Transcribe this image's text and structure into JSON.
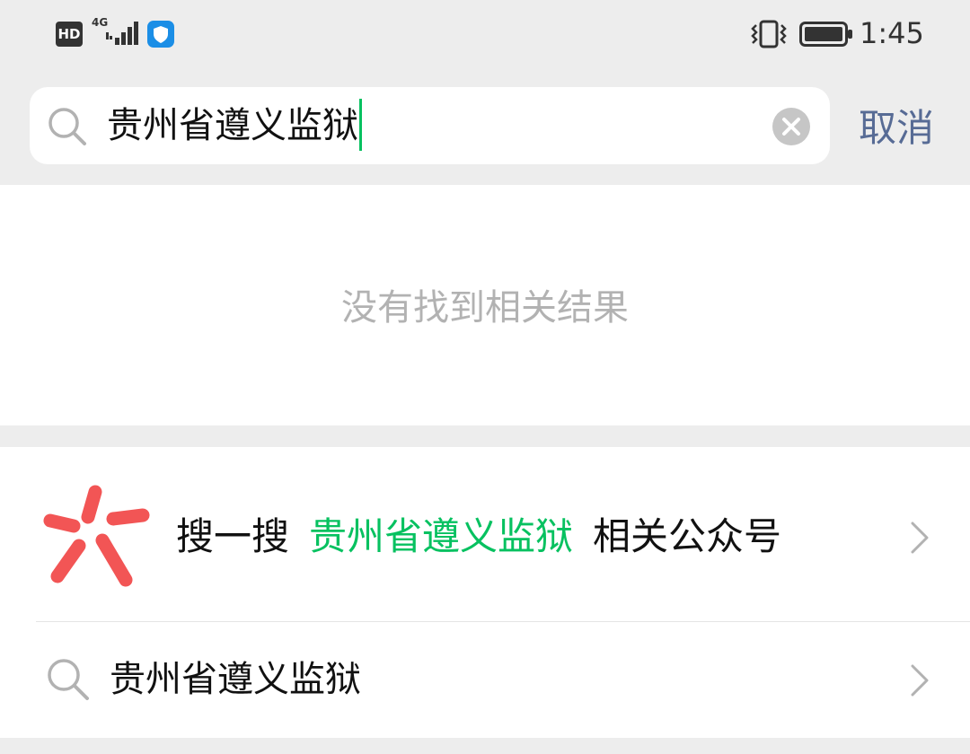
{
  "status_bar": {
    "hd": "HD",
    "network": "4G",
    "time": "1:45",
    "icons": [
      "hd-icon",
      "signal-icon",
      "shield-icon",
      "vibrate-icon",
      "battery-icon"
    ]
  },
  "search": {
    "query": "贵州省遵义监狱",
    "cancel_label": "取消",
    "caret_color": "#07c160"
  },
  "results": {
    "empty_message": "没有找到相关结果",
    "sou_prefix": "搜一搜",
    "sou_keyword": "贵州省遵义监狱",
    "sou_suffix": "相关公众号",
    "query_suggestion": "贵州省遵义监狱"
  },
  "colors": {
    "accent_green": "#07c160",
    "link_blue": "#576b95",
    "logo_red": "#f25555",
    "muted_text": "#b2b2b2"
  }
}
